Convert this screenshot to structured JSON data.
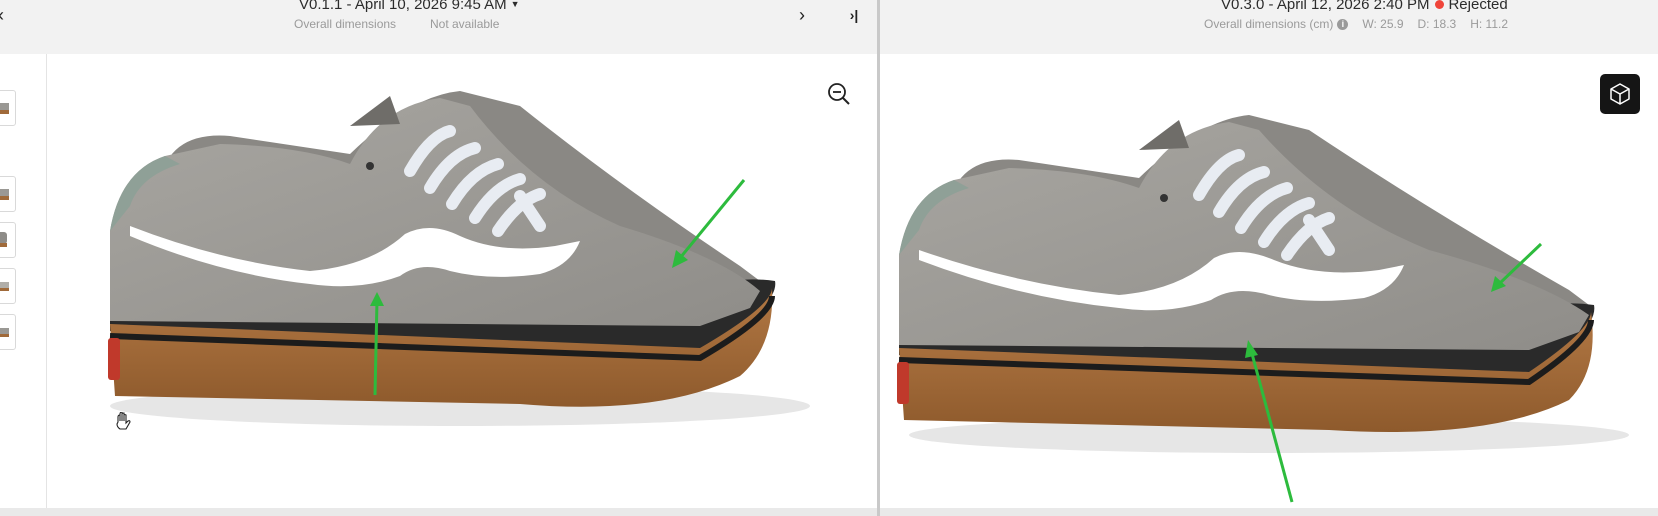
{
  "left": {
    "version_label": "V0.1.1 - April 10, 2026 9:45 AM",
    "dimensions_label": "Overall dimensions",
    "dimensions_value": "Not available",
    "prev_icon": "chevron-left-icon",
    "next_icon": "chevron-right-icon",
    "last_icon": "skip-to-end-icon",
    "zoom_icon": "zoom-out-icon",
    "pan_cursor_icon": "hand-icon"
  },
  "right": {
    "version_label": "V0.3.0 - April 12, 2026 2:40 PM",
    "status_label": "Rejected",
    "status_color": "#f0453a",
    "dimensions_label": "Overall dimensions (cm)",
    "width": "W: 25.9",
    "depth": "D: 18.3",
    "height": "H: 11.2",
    "cube_icon": "3d-cube-icon"
  },
  "colors": {
    "annotation_arrow": "#2dbb3d",
    "shoe_upper": "#9a9894",
    "shoe_sole": "#a06a3a",
    "cube_button_bg": "#151515"
  }
}
